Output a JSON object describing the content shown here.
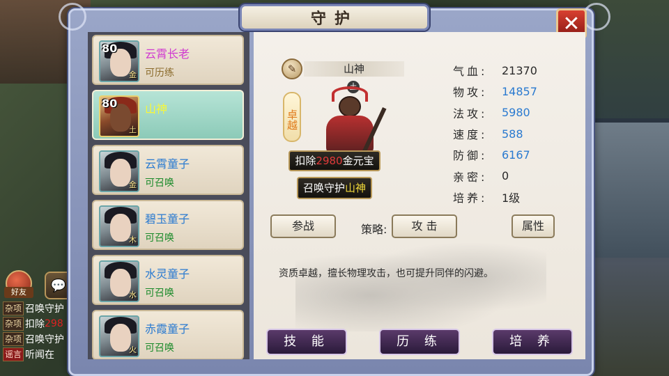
{
  "window": {
    "title": "守护",
    "close_label": "✕"
  },
  "guardians": [
    {
      "level": "80",
      "name": "云霄长老",
      "status": "可历练",
      "element": "金"
    },
    {
      "level": "80",
      "name": "山神",
      "status": "",
      "element": "土"
    },
    {
      "level": "",
      "name": "云霄童子",
      "status": "可召唤",
      "element": "金"
    },
    {
      "level": "",
      "name": "碧玉童子",
      "status": "可召唤",
      "element": "木"
    },
    {
      "level": "",
      "name": "水灵童子",
      "status": "可召唤",
      "element": "水"
    },
    {
      "level": "",
      "name": "赤霞童子",
      "status": "可召唤",
      "element": "火"
    }
  ],
  "selected": {
    "name": "山神",
    "element": "土",
    "grade": "卓越",
    "cost_prefix": "扣除",
    "cost_amount": "2980",
    "cost_suffix": "金元宝",
    "summon_prefix": "召唤守护",
    "summon_name": "山神"
  },
  "stats": [
    {
      "label": "气血:",
      "value": "21370"
    },
    {
      "label": "物攻:",
      "value": "14857"
    },
    {
      "label": "法攻:",
      "value": "5980"
    },
    {
      "label": "速度:",
      "value": "588"
    },
    {
      "label": "防御:",
      "value": "6167"
    },
    {
      "label": "亲密:",
      "value": "0"
    },
    {
      "label": "培养:",
      "value": "1级"
    }
  ],
  "actions": {
    "join_battle": "参战",
    "strategy_label": "策略:",
    "strategy_value": "攻 击",
    "attributes": "属性"
  },
  "description": "资质卓越，擅长物理攻击，也可提升同伴的闪避。",
  "bottom_tabs": {
    "skills": "技 能",
    "training": "历 练",
    "cultivate": "培 养"
  },
  "chat": {
    "friend_label": "好友",
    "lines": [
      {
        "tag": "杂项",
        "text": "召唤守护"
      },
      {
        "tag": "杂项",
        "text": "扣除",
        "highlight": "298"
      },
      {
        "tag": "杂项",
        "text": "召唤守护"
      },
      {
        "tag": "谣言",
        "text": "听闻在"
      }
    ]
  },
  "colors": {
    "accent_red": "#e03a3a",
    "stat_blue": "#2a7ad0",
    "selected_card": "#8ccab8"
  }
}
